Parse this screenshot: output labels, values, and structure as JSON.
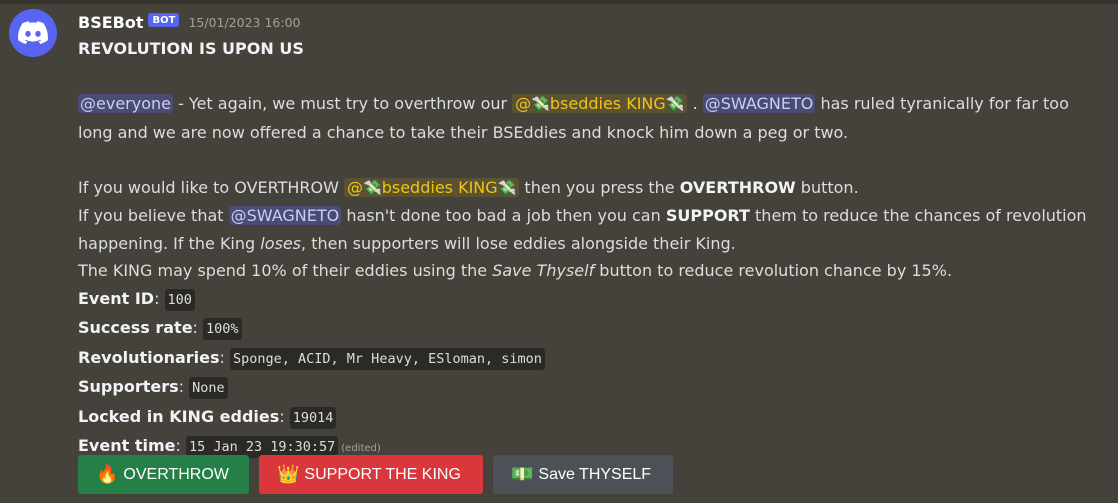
{
  "message": {
    "username": "BSEBot",
    "bot_tag": "BOT",
    "timestamp": "15/01/2023 16:00",
    "title": "REVOLUTION IS UPON US",
    "everyone": "@everyone",
    "p1_a": " - Yet again, we must try to overthrow our ",
    "king_role": "bseddies KING",
    "p1_b": " . ",
    "swagneto": "@SWAGNETO",
    "p1_c": " has ruled tyranically for far too long and we are now offered a chance to take their BSEddies and knock him down a peg or two.",
    "p2_a": "If you would like to OVERTHROW ",
    "p2_b": " then you press the ",
    "p2_bold": "OVERTHROW",
    "p2_c": " button.",
    "p3_a": "If you believe that ",
    "p3_b": " hasn't done too bad a job then you can ",
    "p3_bold": "SUPPORT",
    "p3_c": " them to reduce the chances of revolution happening. If the King ",
    "p3_italic": "loses",
    "p3_d": ", then supporters will lose eddies alongside their King.",
    "p4_a": "The KING may spend 10% of their eddies using the ",
    "p4_italic": "Save Thyself",
    "p4_b": " button to reduce revolution chance by 15%.",
    "fields": [
      {
        "label": "Event ID",
        "value": "100"
      },
      {
        "label": "Success rate",
        "value": "100%"
      },
      {
        "label": "Revolutionaries",
        "value": "Sponge, ACID, Mr Heavy, ESloman, simon"
      },
      {
        "label": "Supporters",
        "value": "None"
      },
      {
        "label": "Locked in KING eddies",
        "value": "19014"
      },
      {
        "label": "Event time",
        "value": "15 Jan 23 19:30:57"
      }
    ],
    "edited": "(edited)"
  },
  "buttons": {
    "overthrow": "OVERTHROW",
    "support": "SUPPORT THE KING",
    "save": "Save THYSELF"
  },
  "icons": {
    "avatar": "discord-logo",
    "overthrow": "fire",
    "support": "crown",
    "save": "money-bill"
  },
  "colors": {
    "background": "#45423b",
    "blurple": "#5865f2",
    "green": "#248046",
    "red": "#da373c",
    "grey": "#4e5058",
    "role_gold": "#f1c40f"
  }
}
